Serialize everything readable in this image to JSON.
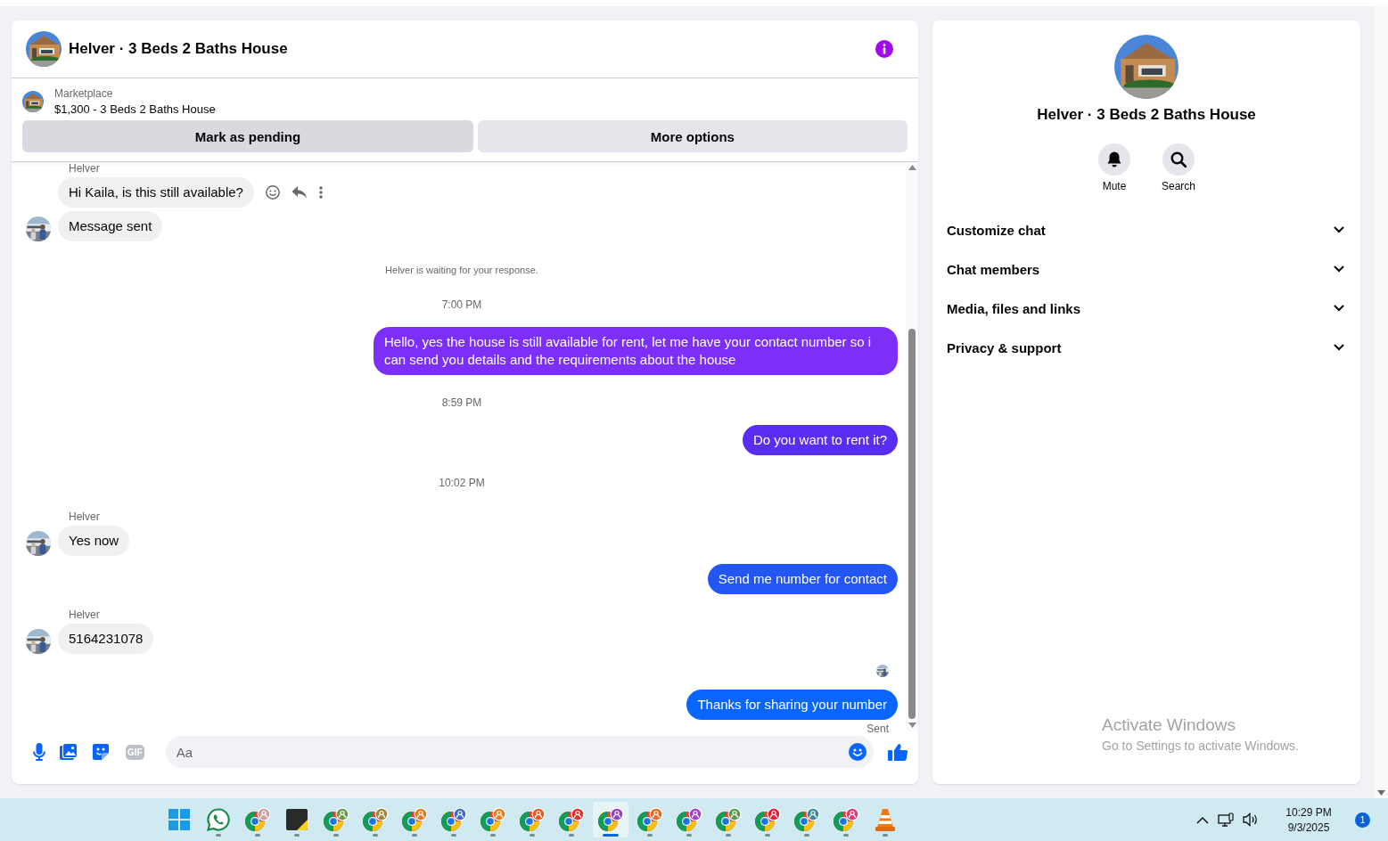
{
  "chat": {
    "title": "Helver · 3 Beds 2 Baths House",
    "listing": {
      "label": "Marketplace",
      "item": "$1,300 - 3 Beds 2 Baths House"
    },
    "actions": [
      "Mark as pending",
      "More options"
    ],
    "messages": [
      {
        "kind": "incoming",
        "sender": "Helver",
        "text": "Hi Kaila, is this still available?",
        "avatar": false,
        "actions": true
      },
      {
        "kind": "incoming",
        "text": "Message sent",
        "avatar": true,
        "actions": false
      },
      {
        "kind": "notice",
        "text": "Helver is waiting for your response."
      },
      {
        "kind": "time",
        "text": "7:00 PM"
      },
      {
        "kind": "outgoing",
        "text": "Hello, yes the house is still available for rent, let me have your contact number so i can send you details and the requirements about the house",
        "color": "#7b2ff7"
      },
      {
        "kind": "time",
        "text": "8:59 PM"
      },
      {
        "kind": "outgoing",
        "text": "Do you want to rent it?",
        "color": "#5a2ef2"
      },
      {
        "kind": "time",
        "text": "10:02 PM"
      },
      {
        "kind": "incoming",
        "sender": "Helver",
        "text": "Yes now",
        "avatar": true,
        "actions": false
      },
      {
        "kind": "outgoing",
        "text": "Send me number for contact",
        "color": "#2456f5"
      },
      {
        "kind": "incoming",
        "sender": "Helver",
        "text": "5164231078",
        "avatar": true,
        "actions": false
      },
      {
        "kind": "seen"
      },
      {
        "kind": "outgoing",
        "text": "Thanks for sharing your number",
        "color": "#0866ff"
      },
      {
        "kind": "status",
        "text": "Sent"
      }
    ],
    "composer": {
      "gif_label": "GIF",
      "placeholder": "Aa"
    }
  },
  "details": {
    "title": "Helver · 3 Beds 2 Baths House",
    "buttons": [
      {
        "kind": "bell",
        "label": "Mute"
      },
      {
        "kind": "search",
        "label": "Search"
      }
    ],
    "sections": [
      {
        "label": "Customize chat",
        "expanded": false
      },
      {
        "label": "Chat members",
        "expanded": false
      },
      {
        "label": "Media, files and links",
        "expanded": false
      },
      {
        "label": "Privacy & support",
        "expanded": false
      }
    ]
  },
  "activation_notice": {
    "title": "Activate Windows",
    "text": "Go to Settings to activate Windows."
  },
  "taskbar": {
    "apps": [
      {
        "kind": "start",
        "active": false
      },
      {
        "kind": "whatsapp",
        "active": false
      },
      {
        "kind": "chrome",
        "color": "#c8a0a0",
        "active": false
      },
      {
        "kind": "notes",
        "active": false
      },
      {
        "kind": "chrome",
        "color": "#6a9a4a",
        "active": false
      },
      {
        "kind": "chrome",
        "color": "#9a8a3a",
        "active": false
      },
      {
        "kind": "chrome",
        "color": "#e07a20",
        "active": false
      },
      {
        "kind": "chrome",
        "color": "#3a6ad0",
        "active": false
      },
      {
        "kind": "chrome",
        "color": "#e8801a",
        "active": false
      },
      {
        "kind": "chrome",
        "color": "#e85a20",
        "active": false
      },
      {
        "kind": "chrome",
        "color": "#e0302a",
        "active": false
      },
      {
        "kind": "chrome",
        "color": "#9040c8",
        "active": true
      },
      {
        "kind": "chrome",
        "color": "#e86a20",
        "active": false
      },
      {
        "kind": "chrome",
        "color": "#a040d0",
        "active": false
      },
      {
        "kind": "chrome",
        "color": "#5a9a4a",
        "active": false
      },
      {
        "kind": "chrome",
        "color": "#e0203a",
        "active": false
      },
      {
        "kind": "chrome",
        "color": "#3a8a9a",
        "active": false
      },
      {
        "kind": "chrome",
        "color": "#e03a7a",
        "active": false
      },
      {
        "kind": "vlc",
        "active": false
      }
    ],
    "tray": {
      "time": "10:29 PM",
      "date": "9/3/2025",
      "notifications": "1"
    }
  }
}
